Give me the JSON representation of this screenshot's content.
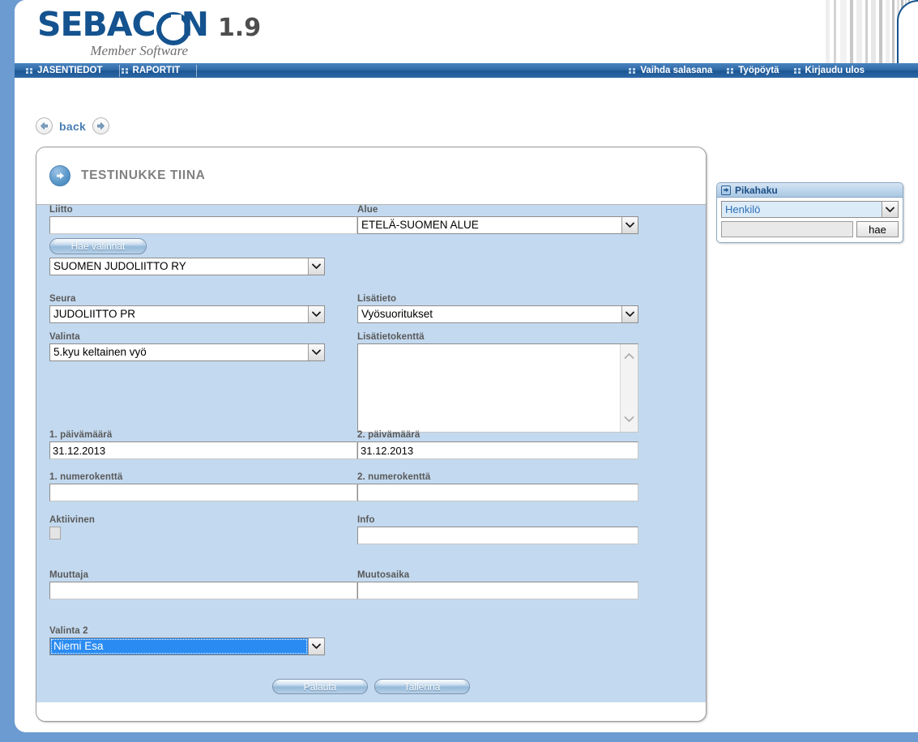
{
  "brand": {
    "name_part1": "SEBAC",
    "name_part2": "N",
    "version": "1.9",
    "tagline": "Member Software"
  },
  "nav": {
    "left_items": [
      {
        "label": "JASENTIEDOT",
        "icon": "dots-icon"
      },
      {
        "label": "RAPORTIT",
        "icon": "dots-icon"
      }
    ],
    "right_items": [
      {
        "label": "Vaihda salasana",
        "icon": "dots-icon"
      },
      {
        "label": "Työpöytä",
        "icon": "dots-icon"
      },
      {
        "label": "Kirjaudu ulos",
        "icon": "dots-icon"
      }
    ]
  },
  "backbar": {
    "prev_icon": "arrow-left-icon",
    "label": "back",
    "next_icon": "arrow-right-icon"
  },
  "card": {
    "title": "TESTINUKKE TIINA",
    "title_icon": "arrow-right-circle-icon"
  },
  "form": {
    "liitto": {
      "label": "Liitto",
      "input_value": "",
      "button_label": "Hae valinnat",
      "select_value": "SUOMEN JUDOLIITTO RY"
    },
    "seura": {
      "label": "Seura",
      "value": "JUDOLIITTO PR"
    },
    "valinta": {
      "label": "Valinta",
      "value": "5.kyu keltainen vyö"
    },
    "alue": {
      "label": "Alue",
      "value": "ETELÄ-SUOMEN ALUE"
    },
    "lisatieto": {
      "label": "Lisätieto",
      "value": "Vyösuoritukset"
    },
    "lisatietokentta": {
      "label": "Lisätietokenttä",
      "value": ""
    },
    "paivamaara1": {
      "label": "1. päivämäärä",
      "value": "31.12.2013"
    },
    "paivamaara2": {
      "label": "2. päivämäärä",
      "value": "31.12.2013"
    },
    "numerokentta1": {
      "label": "1. numerokenttä",
      "value": ""
    },
    "numerokentta2": {
      "label": "2. numerokenttä",
      "value": ""
    },
    "aktiivinen": {
      "label": "Aktiivinen",
      "checked": false
    },
    "info": {
      "label": "Info",
      "value": ""
    },
    "muuttaja": {
      "label": "Muuttaja",
      "value": ""
    },
    "muutosaika": {
      "label": "Muutosaika",
      "value": ""
    },
    "valinta2": {
      "label": "Valinta 2",
      "value": "Niemi Esa",
      "focused": true
    },
    "buttons": {
      "reset": "Palauta",
      "save": "Tallenna"
    }
  },
  "quicksearch": {
    "title": "Pikahaku",
    "title_icon": "arrow-right-box-icon",
    "select_value": "Henkilö",
    "input_value": "",
    "input_placeholder": "",
    "button_label": "hae"
  },
  "colors": {
    "brand_blue": "#14538f",
    "nav_blue": "#2e6aa8",
    "form_bg": "#c3d9ef",
    "page_blue": "#6b9bd1",
    "link_blue": "#4a7fb5",
    "select_highlight": "#2a8bf2"
  }
}
